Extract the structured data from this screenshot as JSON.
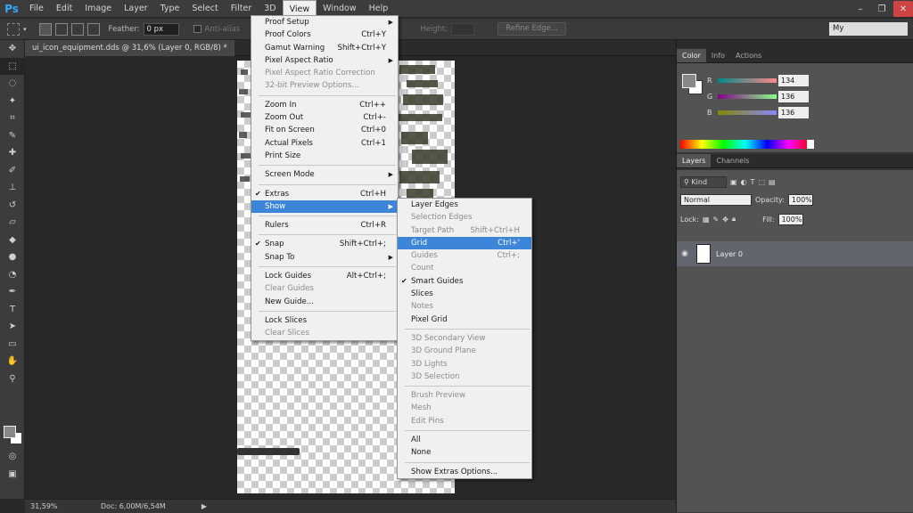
{
  "menubar": {
    "logo": "Ps",
    "items": [
      "File",
      "Edit",
      "Image",
      "Layer",
      "Type",
      "Select",
      "Filter",
      "3D",
      "View",
      "Window",
      "Help"
    ],
    "active": "View"
  },
  "options_bar": {
    "feather_label": "Feather:",
    "feather_value": "0 px",
    "antialias_label": "Anti-alias",
    "height_label": "Height:",
    "refine_edge": "Refine Edge...",
    "workspace": "My"
  },
  "document": {
    "tab_title": "ui_icon_equipment.dds @ 31,6% (Layer 0, RGB/8) *"
  },
  "status_bar": {
    "zoom": "31,59%",
    "doc_size": "Doc: 6,00M/6,54M"
  },
  "color_panel": {
    "tabs": [
      "Color",
      "Info",
      "Actions"
    ],
    "r_label": "R",
    "g_label": "G",
    "b_label": "B",
    "r": "134",
    "g": "136",
    "b": "136"
  },
  "layers_panel": {
    "tabs": [
      "Layers",
      "Channels"
    ],
    "kind": "Kind",
    "blend_mode": "Normal",
    "opacity_label": "Opacity:",
    "opacity": "100%",
    "lock_label": "Lock:",
    "fill_label": "Fill:",
    "fill": "100%",
    "layer_name": "Layer 0"
  },
  "view_menu": {
    "groups": [
      [
        {
          "label": "Proof Setup",
          "submenu": true
        },
        {
          "label": "Proof Colors",
          "shortcut": "Ctrl+Y"
        },
        {
          "label": "Gamut Warning",
          "shortcut": "Shift+Ctrl+Y"
        },
        {
          "label": "Pixel Aspect Ratio",
          "submenu": true
        },
        {
          "label": "Pixel Aspect Ratio Correction",
          "disabled": true
        },
        {
          "label": "32-bit Preview Options...",
          "disabled": true
        }
      ],
      [
        {
          "label": "Zoom In",
          "shortcut": "Ctrl++"
        },
        {
          "label": "Zoom Out",
          "shortcut": "Ctrl+-"
        },
        {
          "label": "Fit on Screen",
          "shortcut": "Ctrl+0"
        },
        {
          "label": "Actual Pixels",
          "shortcut": "Ctrl+1"
        },
        {
          "label": "Print Size"
        }
      ],
      [
        {
          "label": "Screen Mode",
          "submenu": true
        }
      ],
      [
        {
          "label": "Extras",
          "shortcut": "Ctrl+H",
          "checked": true
        },
        {
          "label": "Show",
          "submenu": true,
          "highlighted": true
        }
      ],
      [
        {
          "label": "Rulers",
          "shortcut": "Ctrl+R"
        }
      ],
      [
        {
          "label": "Snap",
          "shortcut": "Shift+Ctrl+;",
          "checked": true
        },
        {
          "label": "Snap To",
          "submenu": true
        }
      ],
      [
        {
          "label": "Lock Guides",
          "shortcut": "Alt+Ctrl+;"
        },
        {
          "label": "Clear Guides",
          "disabled": true
        },
        {
          "label": "New Guide..."
        }
      ],
      [
        {
          "label": "Lock Slices"
        },
        {
          "label": "Clear Slices",
          "disabled": true
        }
      ]
    ]
  },
  "show_submenu": {
    "groups": [
      [
        {
          "label": "Layer Edges"
        },
        {
          "label": "Selection Edges",
          "disabled": true
        },
        {
          "label": "Target Path",
          "shortcut": "Shift+Ctrl+H",
          "disabled": true
        },
        {
          "label": "Grid",
          "shortcut": "Ctrl+'",
          "highlighted": true
        },
        {
          "label": "Guides",
          "shortcut": "Ctrl+;",
          "disabled": true
        },
        {
          "label": "Count",
          "disabled": true
        },
        {
          "label": "Smart Guides",
          "checked": true
        },
        {
          "label": "Slices"
        },
        {
          "label": "Notes",
          "disabled": true
        },
        {
          "label": "Pixel Grid"
        }
      ],
      [
        {
          "label": "3D Secondary View",
          "disabled": true
        },
        {
          "label": "3D Ground Plane",
          "disabled": true
        },
        {
          "label": "3D Lights",
          "disabled": true
        },
        {
          "label": "3D Selection",
          "disabled": true
        }
      ],
      [
        {
          "label": "Brush Preview",
          "disabled": true
        },
        {
          "label": "Mesh",
          "disabled": true
        },
        {
          "label": "Edit Pins",
          "disabled": true
        }
      ],
      [
        {
          "label": "All"
        },
        {
          "label": "None"
        }
      ],
      [
        {
          "label": "Show Extras Options..."
        }
      ]
    ]
  },
  "colors": {
    "accent": "#3c85d8",
    "app_bg": "#282828",
    "panel_bg": "#535353"
  }
}
